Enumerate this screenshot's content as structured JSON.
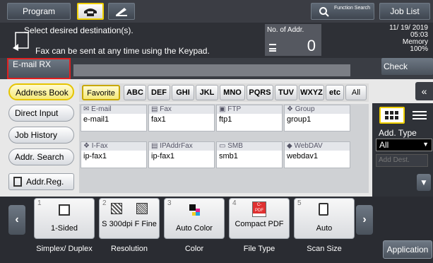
{
  "topbar": {
    "program": "Program",
    "function_search": "Function Search",
    "job_list": "Job List"
  },
  "message": {
    "line1": "Select desired destination(s).",
    "line2": "Fax can be sent at any time using the Keypad.",
    "no_of_addr_label": "No. of Addr.",
    "no_of_addr_value": "0",
    "date": "11/ 19/ 2019",
    "time": "05:03",
    "memory_label": "Memory",
    "memory_value": "100%"
  },
  "email_rx": "E-mail RX",
  "check_setting": "Check Setting",
  "left_nav": [
    "Address Book",
    "Direct Input",
    "Job History",
    "Addr. Search",
    "Addr.Reg."
  ],
  "tabs": [
    "Favorite",
    "ABC",
    "DEF",
    "GHI",
    "JKL",
    "MNO",
    "PQRS",
    "TUV",
    "WXYZ",
    "etc",
    "All"
  ],
  "destinations": [
    {
      "type": "E-mail",
      "name": "e-mail1"
    },
    {
      "type": "Fax",
      "name": "fax1"
    },
    {
      "type": "FTP",
      "name": "ftp1"
    },
    {
      "type": "Group",
      "name": "group1"
    },
    {
      "type": "I-Fax",
      "name": "ip-fax1"
    },
    {
      "type": "IPAddrFax",
      "name": "ip-fax1"
    },
    {
      "type": "SMB",
      "name": "smb1"
    },
    {
      "type": "WebDAV",
      "name": "webdav1"
    }
  ],
  "add_type": {
    "label": "Add. Type",
    "value": "All",
    "add_dest": "Add Dest."
  },
  "functions": [
    {
      "num": "1",
      "value": "1-Sided",
      "label": "Simplex/ Duplex"
    },
    {
      "num": "2",
      "value": "S 300dpi F Fine",
      "label": "Resolution"
    },
    {
      "num": "3",
      "value": "Auto Color",
      "label": "Color"
    },
    {
      "num": "4",
      "value": "Compact PDF",
      "label": "File Type"
    },
    {
      "num": "5",
      "value": "Auto",
      "label": "Scan Size"
    }
  ],
  "application": "Application",
  "colors": {
    "accent_yellow": "#f5e97a",
    "highlight_red": "#e02020",
    "dark_bg": "#2e3036"
  }
}
